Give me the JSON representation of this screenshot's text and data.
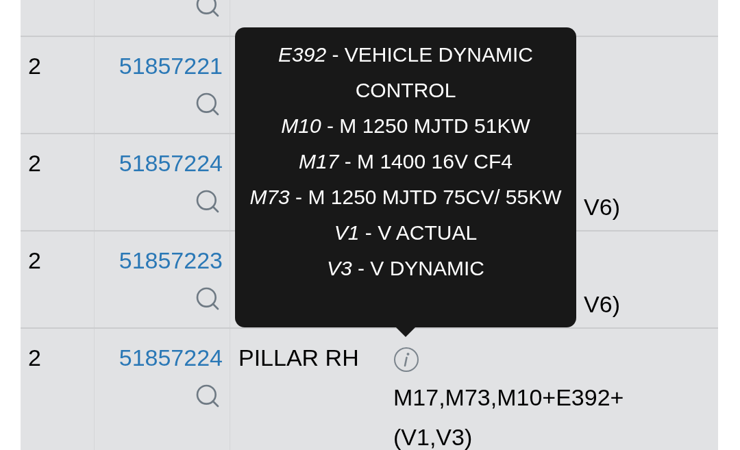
{
  "rows": [
    {
      "qty": "2",
      "part_number": "51857221"
    },
    {
      "qty": "2",
      "part_number": "51857224",
      "notes": [
        "V6)"
      ]
    },
    {
      "qty": "2",
      "part_number": "51857223",
      "notes": [
        "V6)"
      ]
    },
    {
      "qty": "2",
      "part_number": "51857224",
      "description": "PILLAR RH",
      "notes": [
        "M17,M73,M10+E392+",
        "(V1,V3)"
      ]
    }
  ],
  "tooltip": {
    "lines": [
      {
        "code": "E392",
        "text": " -  VEHICLE DYNAMIC CONTROL"
      },
      {
        "code": "M10",
        "text": " - M 1250 MJTD 51KW"
      },
      {
        "code": "M17",
        "text": " - M 1400 16V CF4"
      },
      {
        "code": "M73",
        "text": " - M 1250 MJTD 75CV/ 55KW"
      },
      {
        "code": "V1",
        "text": " - V ACTUAL"
      },
      {
        "code": "V3",
        "text": " - V DYNAMIC"
      }
    ]
  }
}
